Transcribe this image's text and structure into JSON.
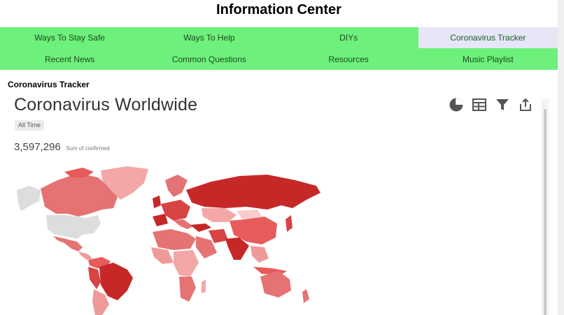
{
  "header": {
    "title": "Information Center"
  },
  "nav": {
    "items": [
      {
        "label": "Ways To Stay Safe"
      },
      {
        "label": "Ways To Help"
      },
      {
        "label": "DIYs"
      },
      {
        "label": "Coronavirus Tracker"
      },
      {
        "label": "Recent News"
      },
      {
        "label": "Common Questions"
      },
      {
        "label": "Resources"
      },
      {
        "label": "Music Playlist"
      }
    ],
    "active": "Coronavirus Tracker"
  },
  "section": {
    "heading": "Coronavirus Tracker"
  },
  "dashboard": {
    "title": "Coronavirus Worldwide",
    "time_filter": "All Time",
    "metric_value": "3,597,296",
    "metric_caption": "Sum of confirmed",
    "toolbar_icons": [
      "pie-chart-icon",
      "table-icon",
      "filter-icon",
      "share-icon"
    ]
  },
  "colors": {
    "nav_bg": "#6ef07c",
    "nav_active_bg": "#e6e6f7",
    "map_dark": "#c62828",
    "map_mid": "#e85b5b",
    "map_light": "#f4a7a7",
    "map_none": "#dddddd"
  }
}
